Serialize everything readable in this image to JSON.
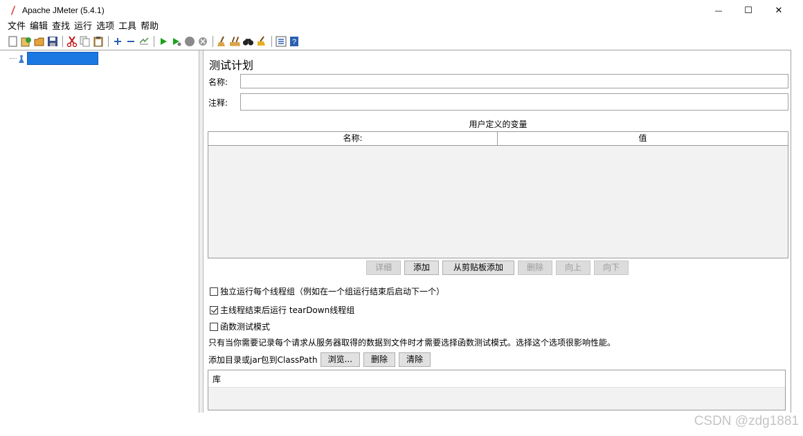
{
  "window": {
    "title": "Apache JMeter (5.4.1)",
    "minimize_glyph": "—",
    "maximize_glyph": "☐",
    "close_glyph": "✕"
  },
  "menubar": [
    "文件",
    "编辑",
    "查找",
    "运行",
    "选项",
    "工具",
    "帮助"
  ],
  "toolbar_icons": [
    "new-icon",
    "templates-icon",
    "open-icon",
    "save-icon",
    "cut-icon",
    "copy-icon",
    "paste-icon",
    "expand-icon",
    "collapse-icon",
    "toggle-icon",
    "start-icon",
    "start-no-pauses-icon",
    "stop-icon",
    "shutdown-icon",
    "clear-icon",
    "clear-all-icon",
    "search-icon",
    "reset-search-icon",
    "function-helper-icon",
    "help-icon"
  ],
  "tree": {
    "selected_label": ""
  },
  "panel": {
    "title": "测试计划",
    "name_label": "名称:",
    "name_value": "",
    "comment_label": "注释:",
    "comment_value": "",
    "variables_caption": "用户定义的变量",
    "columns": [
      "名称:",
      "值"
    ]
  },
  "buttons": {
    "detail": "详细",
    "add": "添加",
    "add_from_clipboard": "从剪贴板添加",
    "delete": "删除",
    "up": "向上",
    "down": "向下"
  },
  "options": {
    "run_independently": {
      "label": "独立运行每个线程组（例如在一个组运行结束后启动下一个）",
      "checked": false
    },
    "teardown_after_shutdown": {
      "label": "主线程结束后运行 tearDown线程组",
      "checked": true
    },
    "functional_mode": {
      "label": "函数测试模式",
      "checked": false
    }
  },
  "functional_note": "只有当你需要记录每个请求从服务器取得的数据到文件时才需要选择函数测试模式。选择这个选项很影响性能。",
  "classpath": {
    "label": "添加目录或jar包到ClassPath",
    "browse": "浏览...",
    "delete": "删除",
    "clear": "清除",
    "table_header": "库"
  },
  "watermark": "CSDN @zdg1881",
  "colors": {
    "selection": "#1b78e2",
    "start_green": "#1aa31a",
    "stop_gray": "#8a8a8a"
  }
}
